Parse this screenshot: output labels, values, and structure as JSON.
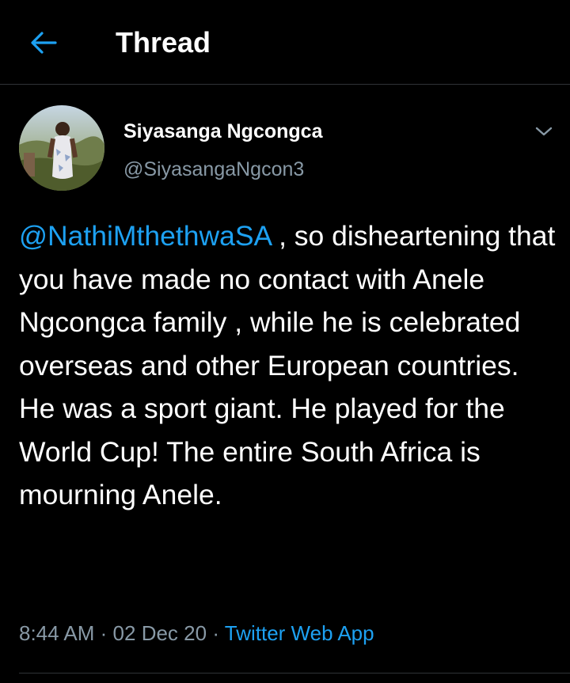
{
  "header": {
    "title": "Thread",
    "back_icon": "arrow-left-icon"
  },
  "tweet": {
    "author": {
      "display_name": "Siyasanga Ngcongca",
      "handle": "@SiyasangaNgcon3"
    },
    "menu_icon": "chevron-down-icon",
    "mention": "@NathiMthethwaSA",
    "text_after_mention": " , so disheartening that you have made no contact with Anele Ngcongca family , while he is celebrated overseas and other European countries. He was a sport giant. He played for the World Cup! The entire South Africa is mourning Anele.",
    "time": "8:44 AM",
    "separator": "·",
    "date": "02 Dec 20",
    "source_app": "Twitter Web App"
  },
  "colors": {
    "background": "#000000",
    "accent": "#1da1f2",
    "secondary_text": "#8899a6",
    "primary_text": "#ffffff",
    "divider": "#2f3336"
  }
}
